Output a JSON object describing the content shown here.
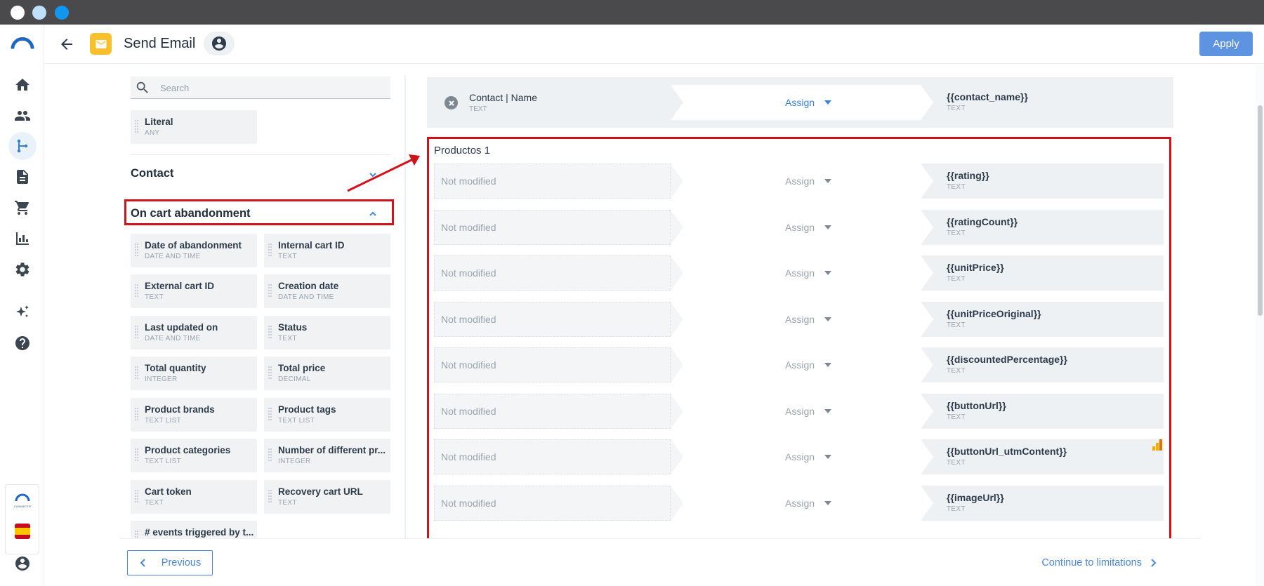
{
  "window": {
    "title": "Send Email"
  },
  "header": {
    "title": "Send Email",
    "apply_label": "Apply"
  },
  "sidebar": {
    "items": [
      {
        "icon": "home-icon"
      },
      {
        "icon": "contacts-icon"
      },
      {
        "icon": "flows-icon",
        "active": true
      },
      {
        "icon": "document-icon"
      },
      {
        "icon": "cart-icon"
      },
      {
        "icon": "reports-icon"
      },
      {
        "icon": "settings-icon"
      },
      {
        "icon": "sparkles-icon"
      },
      {
        "icon": "help-icon"
      }
    ],
    "brand_text": "CONNECTIF"
  },
  "left": {
    "search_placeholder": "Search",
    "literal": {
      "name": "Literal",
      "type": "ANY"
    },
    "contact_section": "Contact",
    "cart_section": "On cart abandonment",
    "fields": [
      {
        "name": "Date of abandonment",
        "type": "DATE AND TIME"
      },
      {
        "name": "Internal cart ID",
        "type": "TEXT"
      },
      {
        "name": "External cart ID",
        "type": "TEXT"
      },
      {
        "name": "Creation date",
        "type": "DATE AND TIME"
      },
      {
        "name": "Last updated on",
        "type": "DATE AND TIME"
      },
      {
        "name": "Status",
        "type": "TEXT"
      },
      {
        "name": "Total quantity",
        "type": "INTEGER"
      },
      {
        "name": "Total price",
        "type": "DECIMAL"
      },
      {
        "name": "Product brands",
        "type": "TEXT LIST"
      },
      {
        "name": "Product tags",
        "type": "TEXT LIST"
      },
      {
        "name": "Product categories",
        "type": "TEXT LIST"
      },
      {
        "name": "Number of different pr...",
        "type": "INTEGER"
      },
      {
        "name": "Cart token",
        "type": "TEXT"
      },
      {
        "name": "Recovery cart URL",
        "type": "TEXT"
      },
      {
        "name": "# events triggered by t...",
        "type": ""
      }
    ]
  },
  "right": {
    "contact_row": {
      "source_name": "Contact | Name",
      "source_type": "TEXT",
      "assign": "Assign",
      "target": "{{contact_name}}",
      "target_type": "TEXT"
    },
    "group_title": "Productos 1",
    "rows": [
      {
        "source": "Not modified",
        "assign": "Assign",
        "target": "{{rating}}",
        "target_type": "TEXT"
      },
      {
        "source": "Not modified",
        "assign": "Assign",
        "target": "{{ratingCount}}",
        "target_type": "TEXT"
      },
      {
        "source": "Not modified",
        "assign": "Assign",
        "target": "{{unitPrice}}",
        "target_type": "TEXT"
      },
      {
        "source": "Not modified",
        "assign": "Assign",
        "target": "{{unitPriceOriginal}}",
        "target_type": "TEXT"
      },
      {
        "source": "Not modified",
        "assign": "Assign",
        "target": "{{discountedPercentage}}",
        "target_type": "TEXT"
      },
      {
        "source": "Not modified",
        "assign": "Assign",
        "target": "{{buttonUrl}}",
        "target_type": "TEXT"
      },
      {
        "source": "Not modified",
        "assign": "Assign",
        "target": "{{buttonUrl_utmContent}}",
        "target_type": "TEXT",
        "badge": "analytics-icon"
      },
      {
        "source": "Not modified",
        "assign": "Assign",
        "target": "{{imageUrl}}",
        "target_type": "TEXT"
      }
    ]
  },
  "footer": {
    "previous_label": "Previous",
    "next_label": "Continue to limitations"
  },
  "colors": {
    "accent": "#4a86d6",
    "apply": "#5d93e0",
    "highlight": "#d0131b",
    "mail_badge": "#f8c02c"
  }
}
